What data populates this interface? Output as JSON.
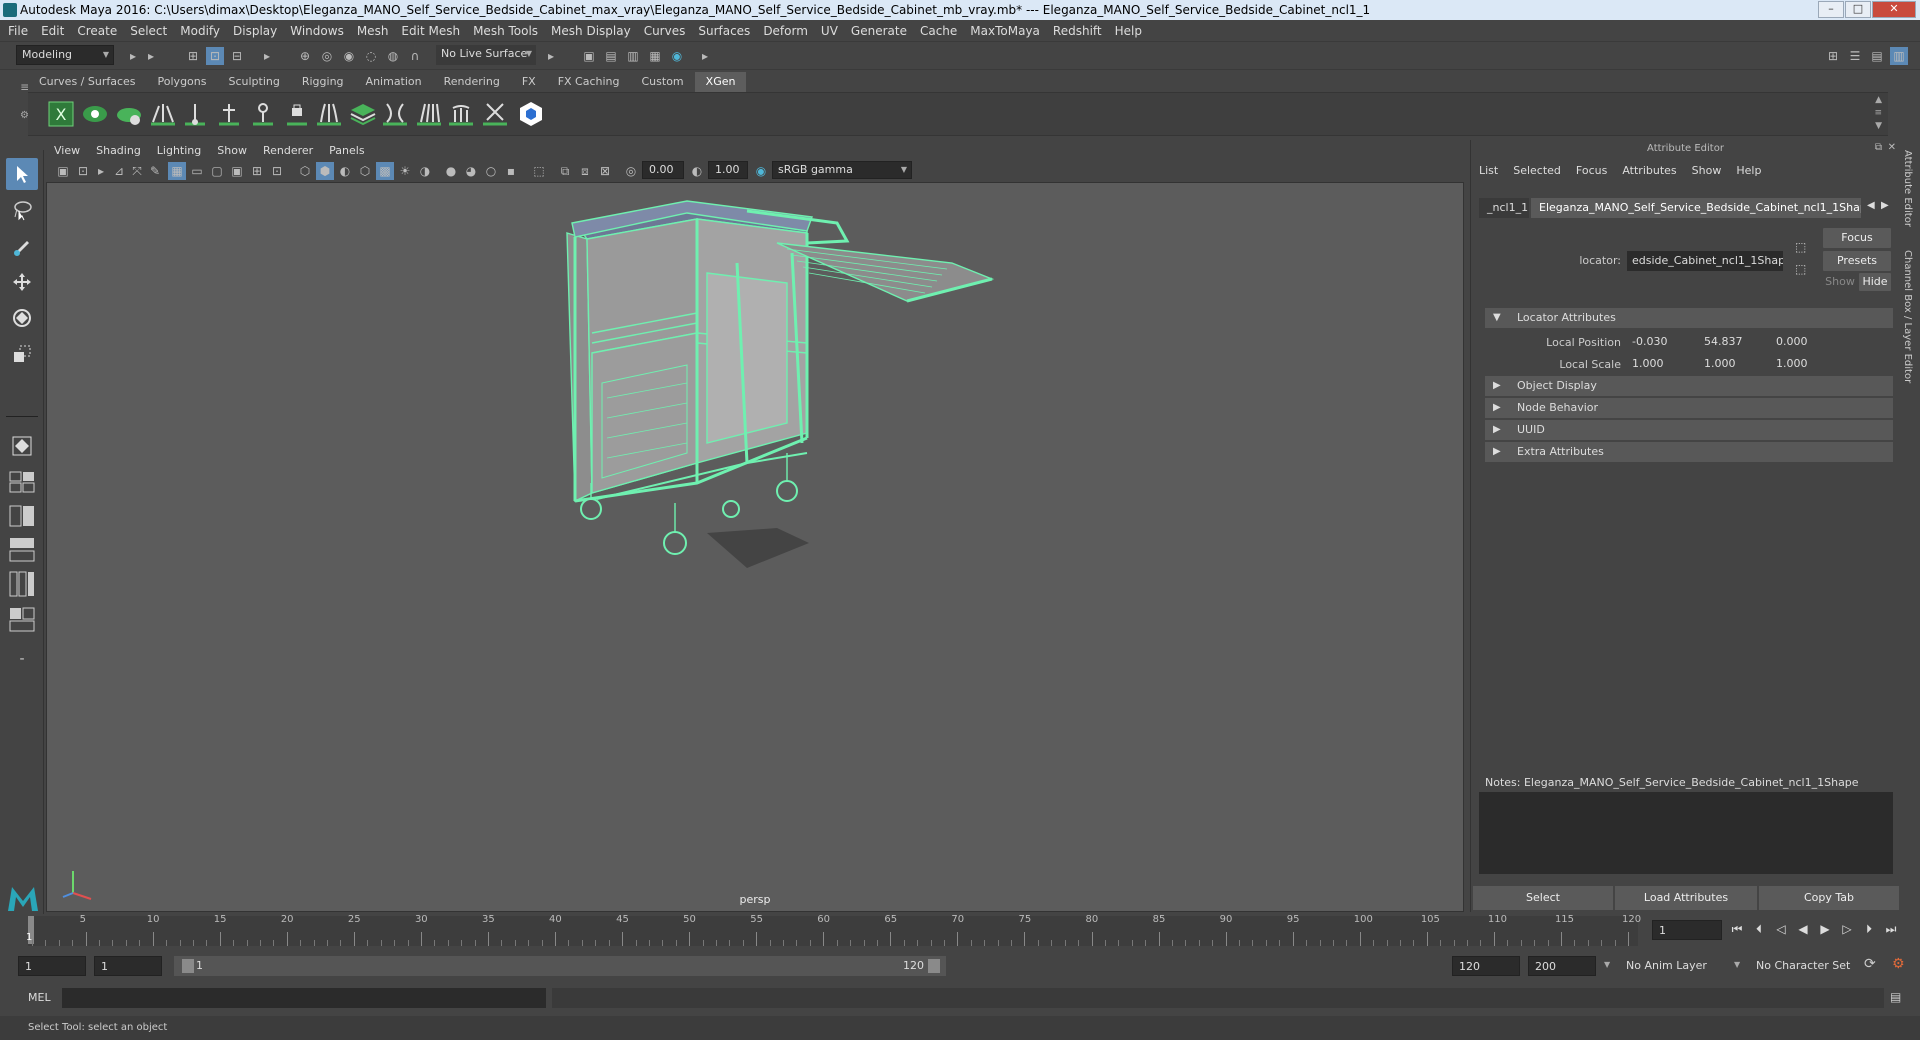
{
  "window": {
    "title": "Autodesk Maya 2016: C:\\Users\\dimax\\Desktop\\Eleganza_MANO_Self_Service_Bedside_Cabinet_max_vray\\Eleganza_MANO_Self_Service_Bedside_Cabinet_mb_vray.mb*   ---   Eleganza_MANO_Self_Service_Bedside_Cabinet_ncl1_1",
    "minimize": "–",
    "maximize": "□",
    "close": "✕"
  },
  "menubar": [
    "File",
    "Edit",
    "Create",
    "Select",
    "Modify",
    "Display",
    "Windows",
    "Mesh",
    "Edit Mesh",
    "Mesh Tools",
    "Mesh Display",
    "Curves",
    "Surfaces",
    "Deform",
    "UV",
    "Generate",
    "Cache",
    "MaxToMaya",
    "Redshift",
    "Help"
  ],
  "statusline": {
    "mode": "Modeling",
    "live_surface": "No Live Surface"
  },
  "shelf": {
    "tabs": [
      "Curves / Surfaces",
      "Polygons",
      "Sculpting",
      "Rigging",
      "Animation",
      "Rendering",
      "FX",
      "FX Caching",
      "Custom",
      "XGen"
    ],
    "active_tab": "XGen"
  },
  "viewport": {
    "menu": [
      "View",
      "Shading",
      "Lighting",
      "Show",
      "Renderer",
      "Panels"
    ],
    "exposure": "0.00",
    "gamma": "1.00",
    "color_space": "sRGB gamma",
    "camera_label": "persp"
  },
  "attribute_editor": {
    "title": "Attribute Editor",
    "menu": [
      "List",
      "Selected",
      "Focus",
      "Attributes",
      "Show",
      "Help"
    ],
    "tab_prev": "_ncl1_1",
    "tab_active": "Eleganza_MANO_Self_Service_Bedside_Cabinet_ncl1_1Shape",
    "locator_label": "locator:",
    "locator_value": "edside_Cabinet_ncl1_1Shape",
    "btn_focus": "Focus",
    "btn_presets": "Presets",
    "btn_show": "Show",
    "btn_hide": "Hide",
    "sections": {
      "locator_attributes": "Locator Attributes",
      "object_display": "Object Display",
      "node_behavior": "Node Behavior",
      "uuid": "UUID",
      "extra_attributes": "Extra Attributes"
    },
    "local_position": {
      "label": "Local Position",
      "x": "-0.030",
      "y": "54.837",
      "z": "0.000"
    },
    "local_scale": {
      "label": "Local Scale",
      "x": "1.000",
      "y": "1.000",
      "z": "1.000"
    },
    "notes_label": "Notes:  Eleganza_MANO_Self_Service_Bedside_Cabinet_ncl1_1Shape",
    "bottom_buttons": {
      "select": "Select",
      "load": "Load Attributes",
      "copy": "Copy Tab"
    }
  },
  "side_tabs": [
    "Attribute Editor",
    "Channel Box / Layer Editor"
  ],
  "timeline": {
    "ticks": [
      "5",
      "10",
      "15",
      "20",
      "25",
      "30",
      "35",
      "40",
      "45",
      "50",
      "55",
      "60",
      "65",
      "70",
      "75",
      "80",
      "85",
      "90",
      "95",
      "100",
      "105",
      "110",
      "115",
      "120"
    ],
    "current_frame_label": "1",
    "current_frame_field": "1"
  },
  "range": {
    "start": "1",
    "playback_start": "1",
    "slider_start": "1",
    "slider_end": "120",
    "playback_end": "120",
    "end": "200",
    "anim_layer": "No Anim Layer",
    "character_set": "No Character Set"
  },
  "mel": {
    "label": "MEL"
  },
  "helpline": "Select Tool: select an object"
}
